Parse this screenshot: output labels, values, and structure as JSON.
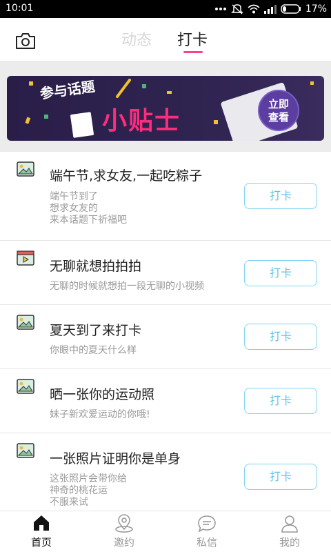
{
  "status_bar": {
    "time": "10:01",
    "battery": "17%"
  },
  "top_nav": {
    "tabs": [
      {
        "label": "动态"
      },
      {
        "label": "打卡"
      }
    ],
    "accent": "#ff3e8f"
  },
  "banner": {
    "title_small": "参与话题",
    "title_big": "小贴士",
    "cta_line1": "立即",
    "cta_line2": "查看"
  },
  "topics": [
    {
      "title": "端午节,求女友,一起吃粽子",
      "desc": "端午节到了\n想求女友的\n来本话题下祈福吧",
      "button": "打卡",
      "icon": "image-icon"
    },
    {
      "title": "无聊就想拍拍拍",
      "desc": "无聊的时候就想拍一段无聊的小视频",
      "button": "打卡",
      "icon": "video-icon"
    },
    {
      "title": "夏天到了来打卡",
      "desc": "你眼中的夏天什么样",
      "button": "打卡",
      "icon": "image-icon"
    },
    {
      "title": "晒一张你的运动照",
      "desc": "妹子新欢爱运动的你哦!",
      "button": "打卡",
      "icon": "image-icon"
    },
    {
      "title": "一张照片证明你是单身",
      "desc": "这张照片会带你给\n神奇的桃花运\n不服来试",
      "button": "打卡",
      "icon": "image-icon"
    }
  ],
  "bottom_nav": [
    {
      "label": "首页",
      "icon": "home-icon"
    },
    {
      "label": "邀约",
      "icon": "location-icon"
    },
    {
      "label": "私信",
      "icon": "message-icon"
    },
    {
      "label": "我的",
      "icon": "user-icon"
    }
  ]
}
